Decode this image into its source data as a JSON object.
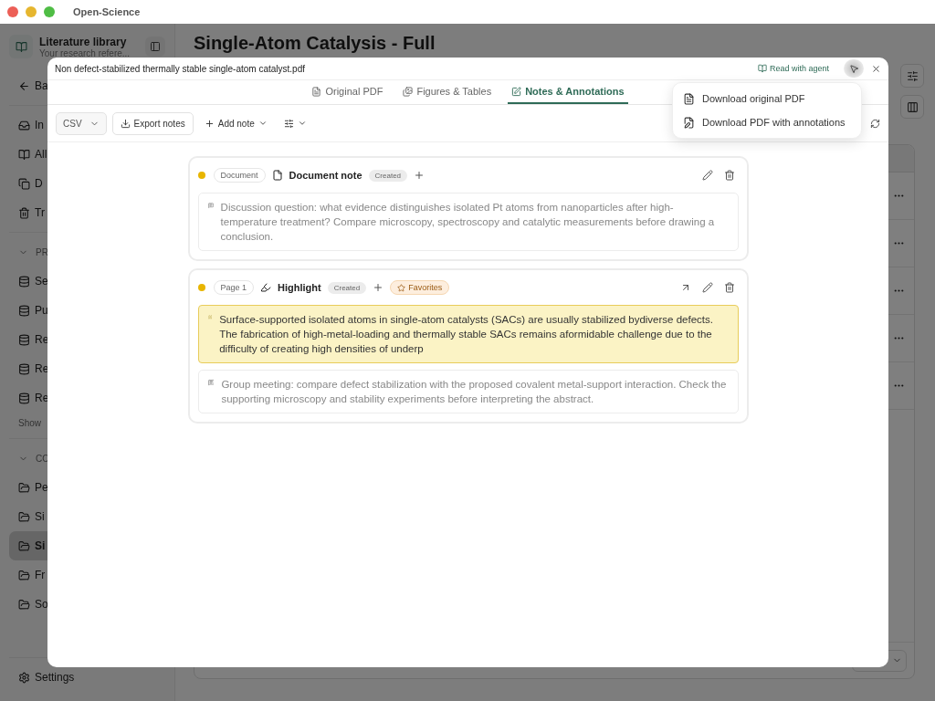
{
  "window": {
    "title": "Open-Science"
  },
  "sidebar": {
    "title": "Literature library",
    "subtitle": "Your research refere...",
    "back": "Ba",
    "nav": [
      {
        "label": "In",
        "kind": "inbox"
      },
      {
        "label": "All",
        "kind": "library"
      },
      {
        "label": "D",
        "kind": "duplicates"
      },
      {
        "label": "Tr",
        "kind": "trash"
      }
    ],
    "sections": [
      {
        "label": "PR",
        "expanded": true,
        "kind": "project",
        "items": [
          {
            "label": "Se",
            "selected": false
          },
          {
            "label": "Pu",
            "selected": false
          },
          {
            "label": "Re",
            "selected": false
          },
          {
            "label": "Re",
            "selected": false
          },
          {
            "label": "Re",
            "selected": false
          }
        ],
        "more": "Show"
      },
      {
        "label": "CO",
        "expanded": true,
        "kind": "collection",
        "items": [
          {
            "label": "Pe",
            "selected": false
          },
          {
            "label": "Si",
            "selected": false
          },
          {
            "label": "Si",
            "selected": true
          },
          {
            "label": "Fr",
            "selected": false
          },
          {
            "label": "So",
            "selected": false
          }
        ]
      }
    ],
    "settings": "Settings"
  },
  "main": {
    "title": "Single-Atom Catalysis - Full"
  },
  "viewer": {
    "file_name": "Non defect-stabilized thermally stable single-atom catalyst.pdf",
    "agent_link": "Read with agent",
    "tabs": [
      {
        "label": "Original PDF",
        "kind": "pdf",
        "selected": false
      },
      {
        "label": "Figures & Tables",
        "kind": "figures",
        "selected": false
      },
      {
        "label": "Notes & Annotations",
        "kind": "notes",
        "selected": true
      }
    ],
    "toolbar": {
      "format": "CSV",
      "export": "Export notes",
      "add": "Add note"
    },
    "download_menu": [
      {
        "label": "Download original PDF",
        "kind": "original"
      },
      {
        "label": "Download PDF with annotations",
        "kind": "annotated"
      }
    ],
    "notes": [
      {
        "kind": "document",
        "color": "#e8b500",
        "location": "Document",
        "title": "Document note",
        "status": "Created",
        "comment": "Discussion question: what evidence distinguishes isolated Pt atoms from nanoparticles after high-temperature treatment? Compare microscopy, spectroscopy and catalytic measurements before drawing a conclusion."
      },
      {
        "kind": "highlight",
        "color": "#e8b500",
        "location": "Page 1",
        "title": "Highlight",
        "status": "Created",
        "tags": [
          "Favorites"
        ],
        "quote": "Surface-supported isolated atoms in single-atom catalysts (SACs) are usually stabilized bydiverse defects. The fabrication of high-metal-loading and thermally stable SACs remains aformidable challenge due to the difficulty of creating high densities of underp",
        "comment": "Group meeting: compare defect stabilization with the proposed covalent metal-support interaction. Check the supporting microscopy and stability experiments before interpreting the abstract."
      }
    ]
  }
}
